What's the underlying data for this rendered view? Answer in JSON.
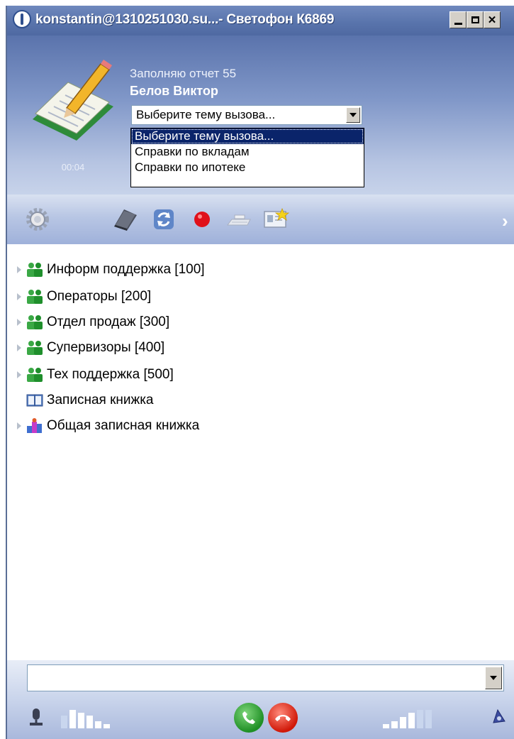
{
  "window": {
    "title": "konstantin@1310251030.su...- Светофон К6869"
  },
  "call": {
    "status": "Заполняю отчет 55",
    "caller": "Белов Виктор",
    "timer": "00:04",
    "topic_selected": "Выберите тему вызова...",
    "topic_options": [
      "Выберите тему вызова...",
      "Справки по вкладам",
      "Справки по ипотеке"
    ]
  },
  "toolbar": {
    "icons": [
      "gear-icon",
      "address-book-icon",
      "refresh-icon",
      "record-icon",
      "keyboard-icon",
      "contact-card-icon",
      "chevron-right-icon"
    ]
  },
  "tree": {
    "items": [
      {
        "label": "Информ поддержка [100]",
        "icon": "group-icon"
      },
      {
        "label": "Операторы [200]",
        "icon": "group-icon"
      },
      {
        "label": "Отдел продаж [300]",
        "icon": "group-icon"
      },
      {
        "label": "Супервизоры [400]",
        "icon": "group-icon"
      },
      {
        "label": "Тех поддержка [500]",
        "icon": "group-icon"
      },
      {
        "label": "Записная книжка",
        "icon": "notebook-icon"
      },
      {
        "label": "Общая записная книжка",
        "icon": "shared-contacts-icon"
      }
    ]
  },
  "bottom": {
    "number_value": "",
    "mic_level": [
      0.4,
      0.55,
      0.7,
      0.85,
      1.0
    ],
    "speaker_level": [
      0.35,
      0.5,
      0.65,
      0.8,
      1.0
    ],
    "icons": [
      "microphone-icon",
      "answer-call-icon",
      "hangup-call-icon",
      "speaker-icon"
    ]
  },
  "colors": {
    "title_bar": "#5873ab",
    "selection": "#0a246a",
    "answer": "#1f8f25",
    "hangup": "#d01808"
  }
}
